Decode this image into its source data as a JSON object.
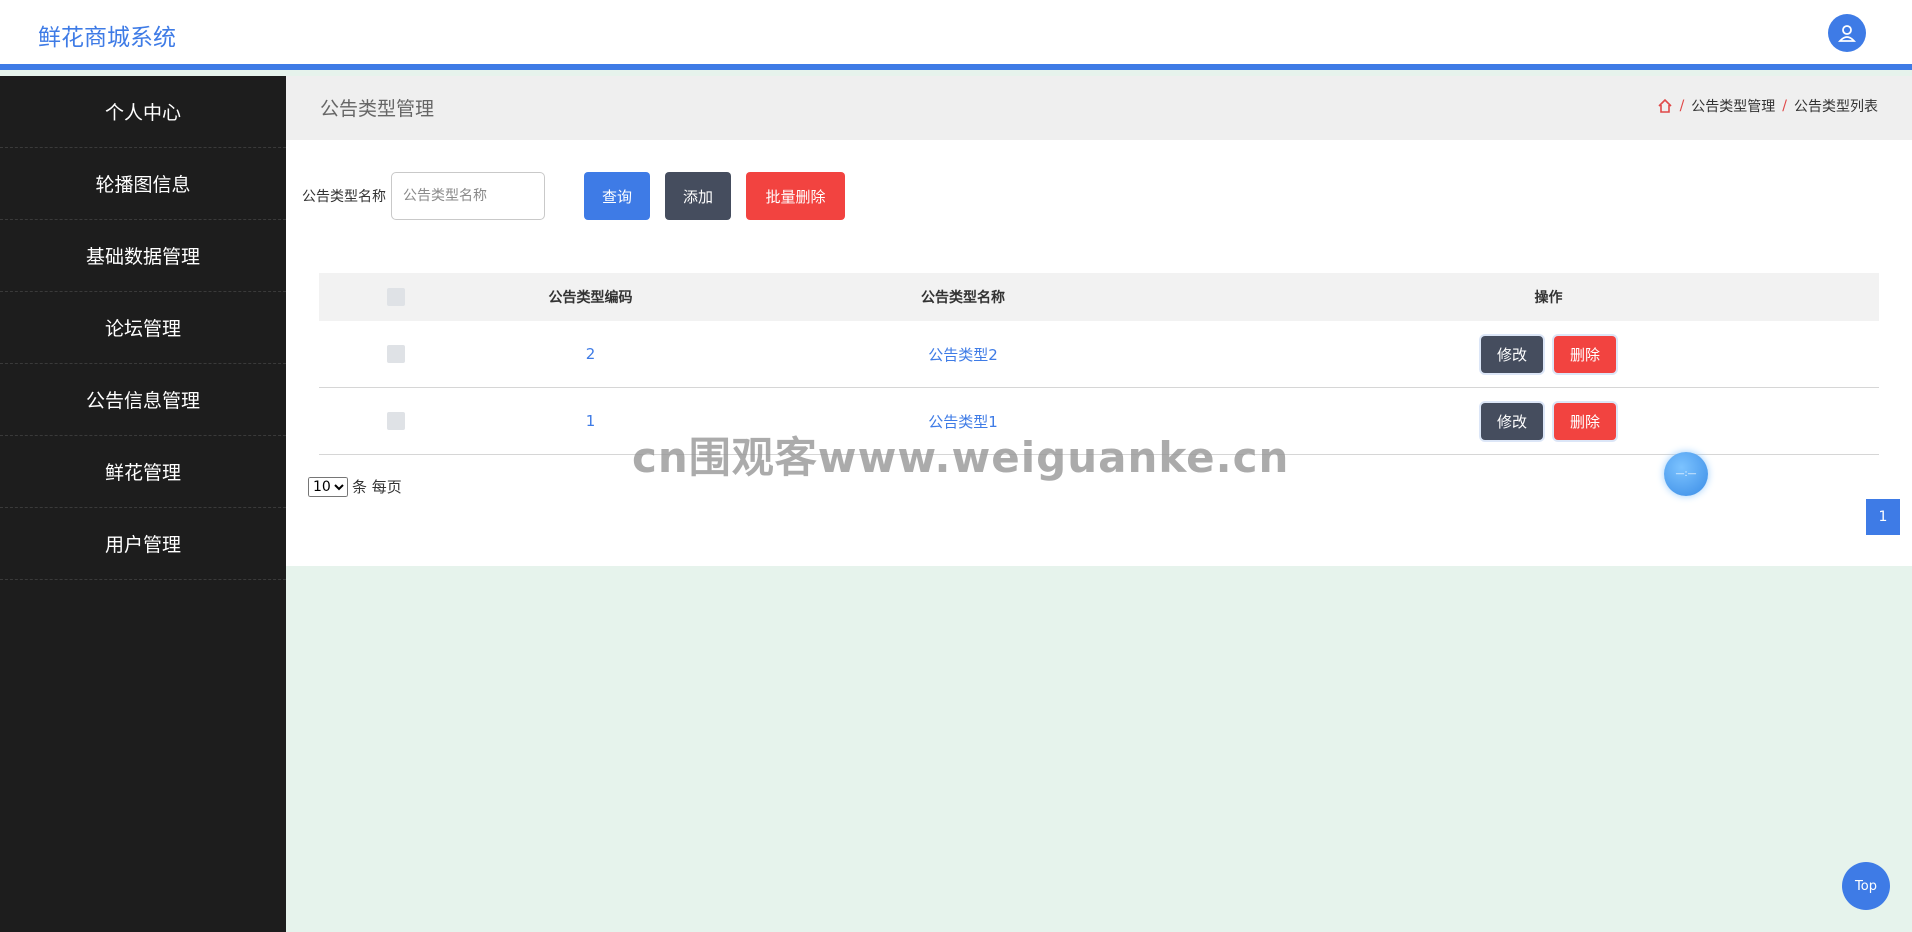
{
  "app": {
    "title": "鲜花商城系统"
  },
  "sidebar": {
    "items": [
      {
        "label": "个人中心"
      },
      {
        "label": "轮播图信息"
      },
      {
        "label": "基础数据管理"
      },
      {
        "label": "论坛管理"
      },
      {
        "label": "公告信息管理"
      },
      {
        "label": "鲜花管理"
      },
      {
        "label": "用户管理"
      }
    ]
  },
  "header": {
    "title": "公告类型管理",
    "breadcrumb": [
      "公告类型管理",
      "公告类型列表"
    ],
    "separator": "/"
  },
  "search": {
    "label": "公告类型名称",
    "placeholder": "公告类型名称",
    "value": ""
  },
  "buttons": {
    "query": "查询",
    "add": "添加",
    "batch_delete": "批量删除",
    "edit": "修改",
    "delete": "删除"
  },
  "table": {
    "columns": [
      "公告类型编码",
      "公告类型名称",
      "操作"
    ],
    "rows": [
      {
        "code": "2",
        "name": "公告类型2"
      },
      {
        "code": "1",
        "name": "公告类型1"
      }
    ]
  },
  "pager": {
    "page_size": "10",
    "page_size_suffix": "条 每页",
    "current_page": "1"
  },
  "float_ball": {
    "text": "—:—"
  },
  "watermark": "cn围观客www.weiguanke.cn",
  "back_to_top": "Top",
  "colors": {
    "accent": "#3e7be6",
    "danger": "#f24340",
    "dark_button": "#454d5e",
    "sidebar_bg": "#1d1d1d",
    "page_bg": "#e6f3ec"
  }
}
